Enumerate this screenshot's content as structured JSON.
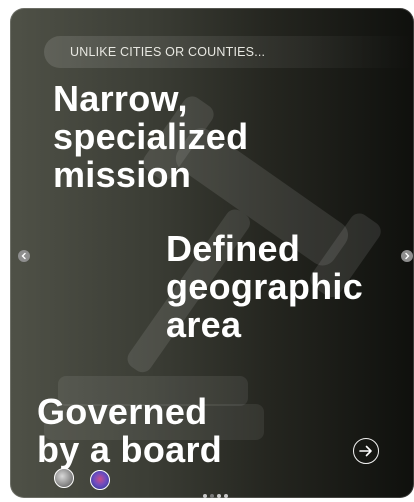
{
  "slide": {
    "eyebrow": "UNLIKE CITIES OR COUNTIES...",
    "points": [
      {
        "line1": "Narrow,",
        "line2": "specialized",
        "line3": "mission"
      },
      {
        "line1": "Defined",
        "line2": "geographic",
        "line3": "area"
      },
      {
        "line1": "Governed",
        "line2": "by a board"
      }
    ]
  },
  "carousel": {
    "prev_icon": "chevron-left-icon",
    "next_icon": "chevron-right-icon",
    "next_button_icon": "arrow-right-circle-icon",
    "total_dots": 4,
    "active_dot": 1
  },
  "background_icon": "gavel-icon",
  "colors": {
    "background_start": "#4f5147",
    "background_end": "#0f100d",
    "text": "#ffffff"
  }
}
